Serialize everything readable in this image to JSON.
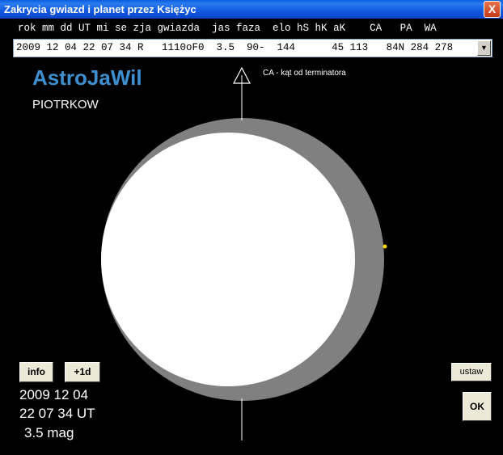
{
  "window": {
    "title": "Zakrycia gwiazd i planet przez Księżyc",
    "close_label": "X"
  },
  "table": {
    "header": "rok mm dd UT mi se zja gwiazda  jas faza  elo hS hK aK    CA   PA  WA",
    "selected_row": "2009 12 04 22 07 34 R   1110oF0  3.5  90-  144      45 113   84N 284 278",
    "dropdown_arrow": "▼"
  },
  "app_name": "AstroJaWil",
  "location": "PIOTRKOW",
  "ca_note": "CA - kąt od terminatora",
  "buttons": {
    "info": "info",
    "plus_day": "+1d",
    "ustaw": "ustaw",
    "ok": "OK"
  },
  "readout": {
    "date": "2009 12 04",
    "time": "22 07 34 UT",
    "mag": "3.5 mag"
  },
  "colors": {
    "moon_lit": "#ffffff",
    "moon_dark": "#808080",
    "star": "#ffd400",
    "app_name": "#3e8fcf"
  }
}
